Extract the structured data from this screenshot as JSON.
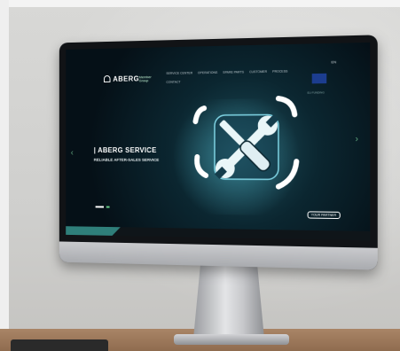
{
  "website": {
    "brand": "ABERG",
    "sub_brand": "Member Group",
    "nav_items": [
      "SERVICE CENTER",
      "OPERATIONS",
      "SPARE PARTS",
      "CUSTOMER",
      "PROCESS",
      "CONTACT"
    ],
    "language": "EN",
    "hero_title": "| ABERG SERVICE",
    "hero_subtitle": "RELIABLE AFTER-SALES SERVICE",
    "partner_button": "YOUR PARTNER",
    "eu_caption": "EU FUNDING"
  },
  "icons": {
    "main_illustration": "wrench-screwdriver-icon",
    "prev_slide": "chevron-left-icon",
    "next_slide": "chevron-right-icon",
    "brand_logo": "aberg-logo-icon",
    "eu_flag": "eu-flag-icon"
  },
  "colors": {
    "screen_bg": "#051017",
    "accent_teal": "#2f7f7a",
    "glow": "#5ac8dc"
  }
}
